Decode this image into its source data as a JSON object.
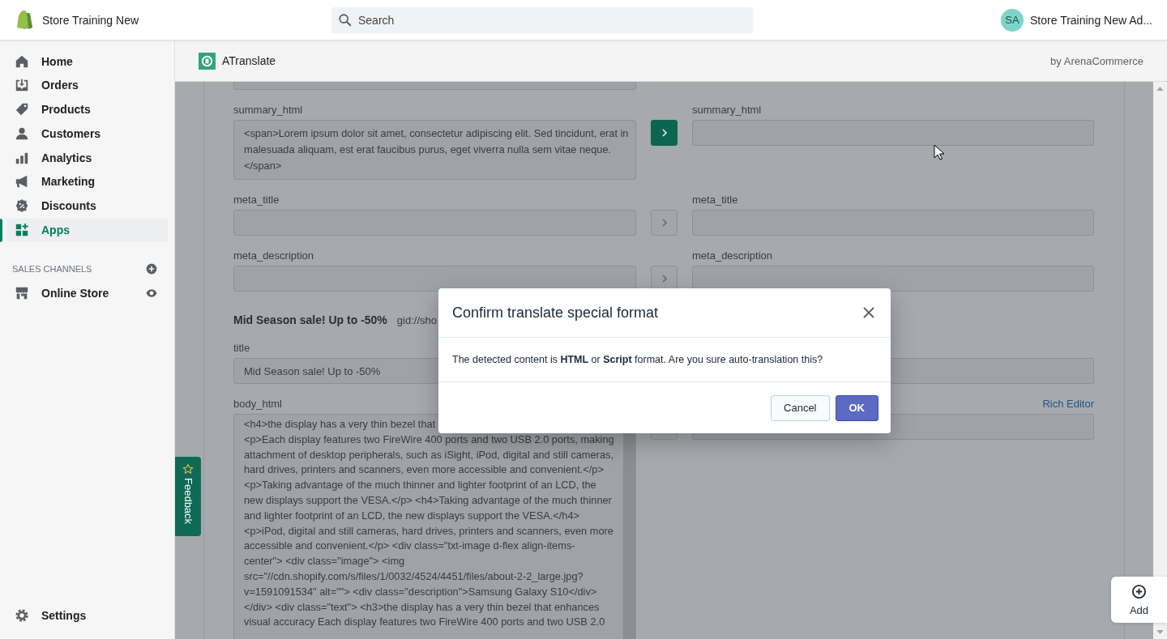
{
  "top_bar": {
    "store_name": "Store Training New",
    "search": {
      "placeholder": "Search"
    },
    "account": {
      "initials": "SA",
      "name": "Store Training New Ad..."
    }
  },
  "sidebar": {
    "items": [
      {
        "kind": "home",
        "label": "Home",
        "selected": false
      },
      {
        "kind": "orders",
        "label": "Orders",
        "selected": false
      },
      {
        "kind": "products",
        "label": "Products",
        "selected": false
      },
      {
        "kind": "customers",
        "label": "Customers",
        "selected": false
      },
      {
        "kind": "analytics",
        "label": "Analytics",
        "selected": false
      },
      {
        "kind": "marketing",
        "label": "Marketing",
        "selected": false
      },
      {
        "kind": "discounts",
        "label": "Discounts",
        "selected": false
      },
      {
        "kind": "apps",
        "label": "Apps",
        "selected": true
      }
    ],
    "sales_channels": {
      "heading": "SALES CHANNELS",
      "items": [
        {
          "kind": "store",
          "label": "Online Store"
        }
      ]
    },
    "settings": {
      "label": "Settings"
    }
  },
  "app_header": {
    "title": "ATranslate",
    "byline": "by ArenaCommerce"
  },
  "rows": [
    {
      "kind": "cut_field"
    },
    {
      "kind": "pair",
      "source": {
        "label": "summary_html",
        "lines": [
          "<span>Lorem ipsum dolor sit amet, consectetur adipiscing elit. Sed tincidunt, erat in",
          "malesuada aliquam, est erat faucibus purus, eget viverra nulla sem vitae neque.",
          "</span>"
        ]
      },
      "translate_button": {
        "enabled": true
      },
      "target": {
        "label": "summary_html"
      }
    },
    {
      "kind": "pair",
      "source": {
        "label": "meta_title"
      },
      "translate_button": {
        "enabled": false
      },
      "target": {
        "label": "meta_title"
      }
    },
    {
      "kind": "pair",
      "source": {
        "label": "meta_description"
      },
      "translate_button": {
        "enabled": false
      },
      "target": {
        "label": "meta_description"
      }
    },
    {
      "kind": "heading",
      "title": "Mid Season sale! Up to -50%",
      "id": "gid://sho"
    },
    {
      "kind": "pair",
      "source": {
        "label": "title",
        "value": "Mid Season sale! Up to -50%"
      },
      "target": {}
    },
    {
      "kind": "pair",
      "source": {
        "label": "body_html",
        "scroll": true,
        "lines": [
          "<h4>the display has a very thin bezel that",
          "<p>Each display features two FireWire 400 ports and two USB 2.0 ports, making",
          "attachment of desktop peripherals, such as iSight, iPod, digital and still cameras,",
          "hard drives, printers and scanners, even more accessible and convenient.</p>",
          "<p>Taking advantage of the much thinner and lighter footprint of an LCD, the",
          "new displays support the VESA.</p> <h4>Taking advantage of the much thinner",
          "and lighter footprint of an LCD, the new displays support the VESA.</h4>",
          "<p>iPod, digital and still cameras, hard drives, printers and scanners, even more",
          "accessible and convenient.</p> <div class=\"txt-image d-flex align-items-",
          "center\"> <div class=\"image\"> <img",
          "src=\"//cdn.shopify.com/s/files/1/0032/4524/4451/files/about-2-2_large.jpg?",
          "v=1591091534\" alt=\"\"> <div class=\"description\">Samsung Galaxy S10</div>",
          "</div> <div class=\"text\"> <h3>the display has a very thin bezel that enhances",
          "visual accuracy Each display features two FireWire 400 ports and two USB 2.0"
        ]
      },
      "translate_button": {
        "enabled": false
      },
      "target": {
        "link": "Rich Editor"
      }
    }
  ],
  "feedback": {
    "label": "Feedback"
  },
  "add_button": {
    "label": "Add"
  },
  "modal": {
    "title": "Confirm translate special format",
    "message": "The detected content is **HTML** or **Script** format. Are you sure auto-translation this?",
    "buttons": [
      {
        "kind": "secondary",
        "label": "Cancel"
      },
      {
        "kind": "primary",
        "label": "OK"
      }
    ]
  }
}
